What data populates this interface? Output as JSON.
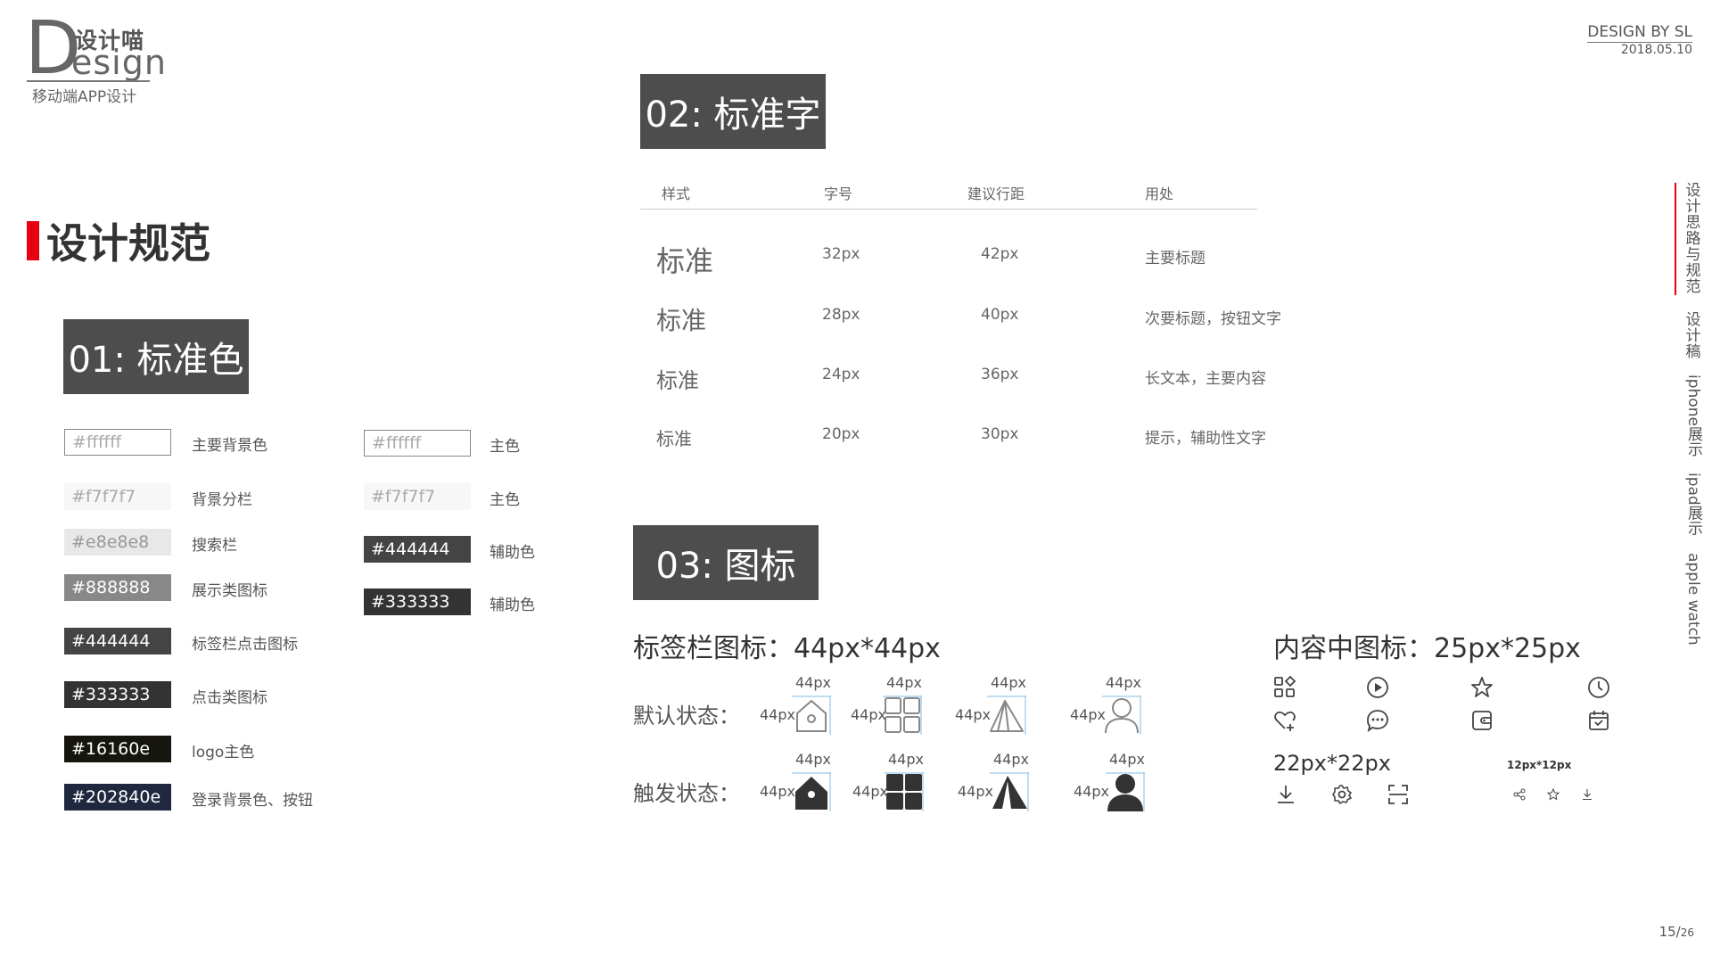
{
  "logo": {
    "letter": "D",
    "cn": "设计喵",
    "en": "esign",
    "sub": "移动端APP设计"
  },
  "brand": {
    "by": "DESIGN BY SL",
    "date": "2018.05.10"
  },
  "main_title": "设计规范",
  "section1": {
    "title": "01: 标准色",
    "left": [
      {
        "code": "#ffffff",
        "label": "主要背景色",
        "bg": "#ffffff",
        "fg": "#aaaaaa",
        "border": true
      },
      {
        "code": "#f7f7f7",
        "label": "背景分栏",
        "bg": "#f7f7f7",
        "fg": "#aaaaaa",
        "border": false
      },
      {
        "code": "#e8e8e8",
        "label": "搜索栏",
        "bg": "#e8e8e8",
        "fg": "#999999",
        "border": false
      },
      {
        "code": "#888888",
        "label": "展示类图标",
        "bg": "#888888",
        "fg": "#ffffff",
        "border": false
      },
      {
        "code": "#444444",
        "label": "标签栏点击图标",
        "bg": "#444444",
        "fg": "#ffffff",
        "border": false
      },
      {
        "code": "#333333",
        "label": "点击类图标",
        "bg": "#333333",
        "fg": "#ffffff",
        "border": false
      },
      {
        "code": "#16160e",
        "label": "logo主色",
        "bg": "#16160e",
        "fg": "#ffffff",
        "border": false
      },
      {
        "code": "#202840e",
        "label": "登录背景色、按钮",
        "bg": "#202840",
        "fg": "#ffffff",
        "border": false
      }
    ],
    "right": [
      {
        "code": "#ffffff",
        "label": "主色",
        "bg": "#ffffff",
        "fg": "#aaaaaa",
        "border": true
      },
      {
        "code": "#f7f7f7",
        "label": "主色",
        "bg": "#f7f7f7",
        "fg": "#aaaaaa",
        "border": false
      },
      {
        "code": "#444444",
        "label": "辅助色",
        "bg": "#444444",
        "fg": "#ffffff",
        "border": false
      },
      {
        "code": "#333333",
        "label": "辅助色",
        "bg": "#333333",
        "fg": "#ffffff",
        "border": false
      }
    ]
  },
  "section2": {
    "title": "02: 标准字",
    "headers": [
      "样式",
      "字号",
      "建议行距",
      "用处"
    ],
    "rows": [
      {
        "style": "标准",
        "size": "32px",
        "line": "42px",
        "use": "主要标题"
      },
      {
        "style": "标准",
        "size": "28px",
        "line": "40px",
        "use": "次要标题，按钮文字"
      },
      {
        "style": "标准",
        "size": "24px",
        "line": "36px",
        "use": "长文本，主要内容"
      },
      {
        "style": "标准",
        "size": "20px",
        "line": "30px",
        "use": "提示，辅助性文字"
      }
    ]
  },
  "section3": {
    "title": "03: 图标",
    "tabbar_title": "标签栏图标：44px*44px",
    "content_title": "内容中图标：25px*25px",
    "default_label": "默认状态：",
    "active_label": "触发状态：",
    "dim": "44px",
    "tab_icons": [
      "home-icon",
      "grid-icon",
      "tent-icon",
      "user-icon"
    ],
    "content_icons_row1": [
      "apps-icon",
      "play-icon",
      "star-icon",
      "clock-icon"
    ],
    "content_icons_row2": [
      "heart-add-icon",
      "chat-icon",
      "wallet-icon",
      "calendar-icon"
    ],
    "size22": "22px*22px",
    "size22_icons": [
      "download-icon",
      "settings-icon",
      "scan-icon"
    ],
    "size12": "12px*12px",
    "size12_icons": [
      "share-icon",
      "star-small-icon",
      "download-small-icon"
    ]
  },
  "side_nav": [
    "设计思路与规范",
    "设计稿",
    "iphone展示",
    "ipad展示",
    "apple watch"
  ],
  "page": {
    "current": "15",
    "total": "26"
  },
  "colors": {
    "accent": "#e60012",
    "section_bg": "#4d4d4d",
    "icon_blue": "#4aa3df"
  }
}
